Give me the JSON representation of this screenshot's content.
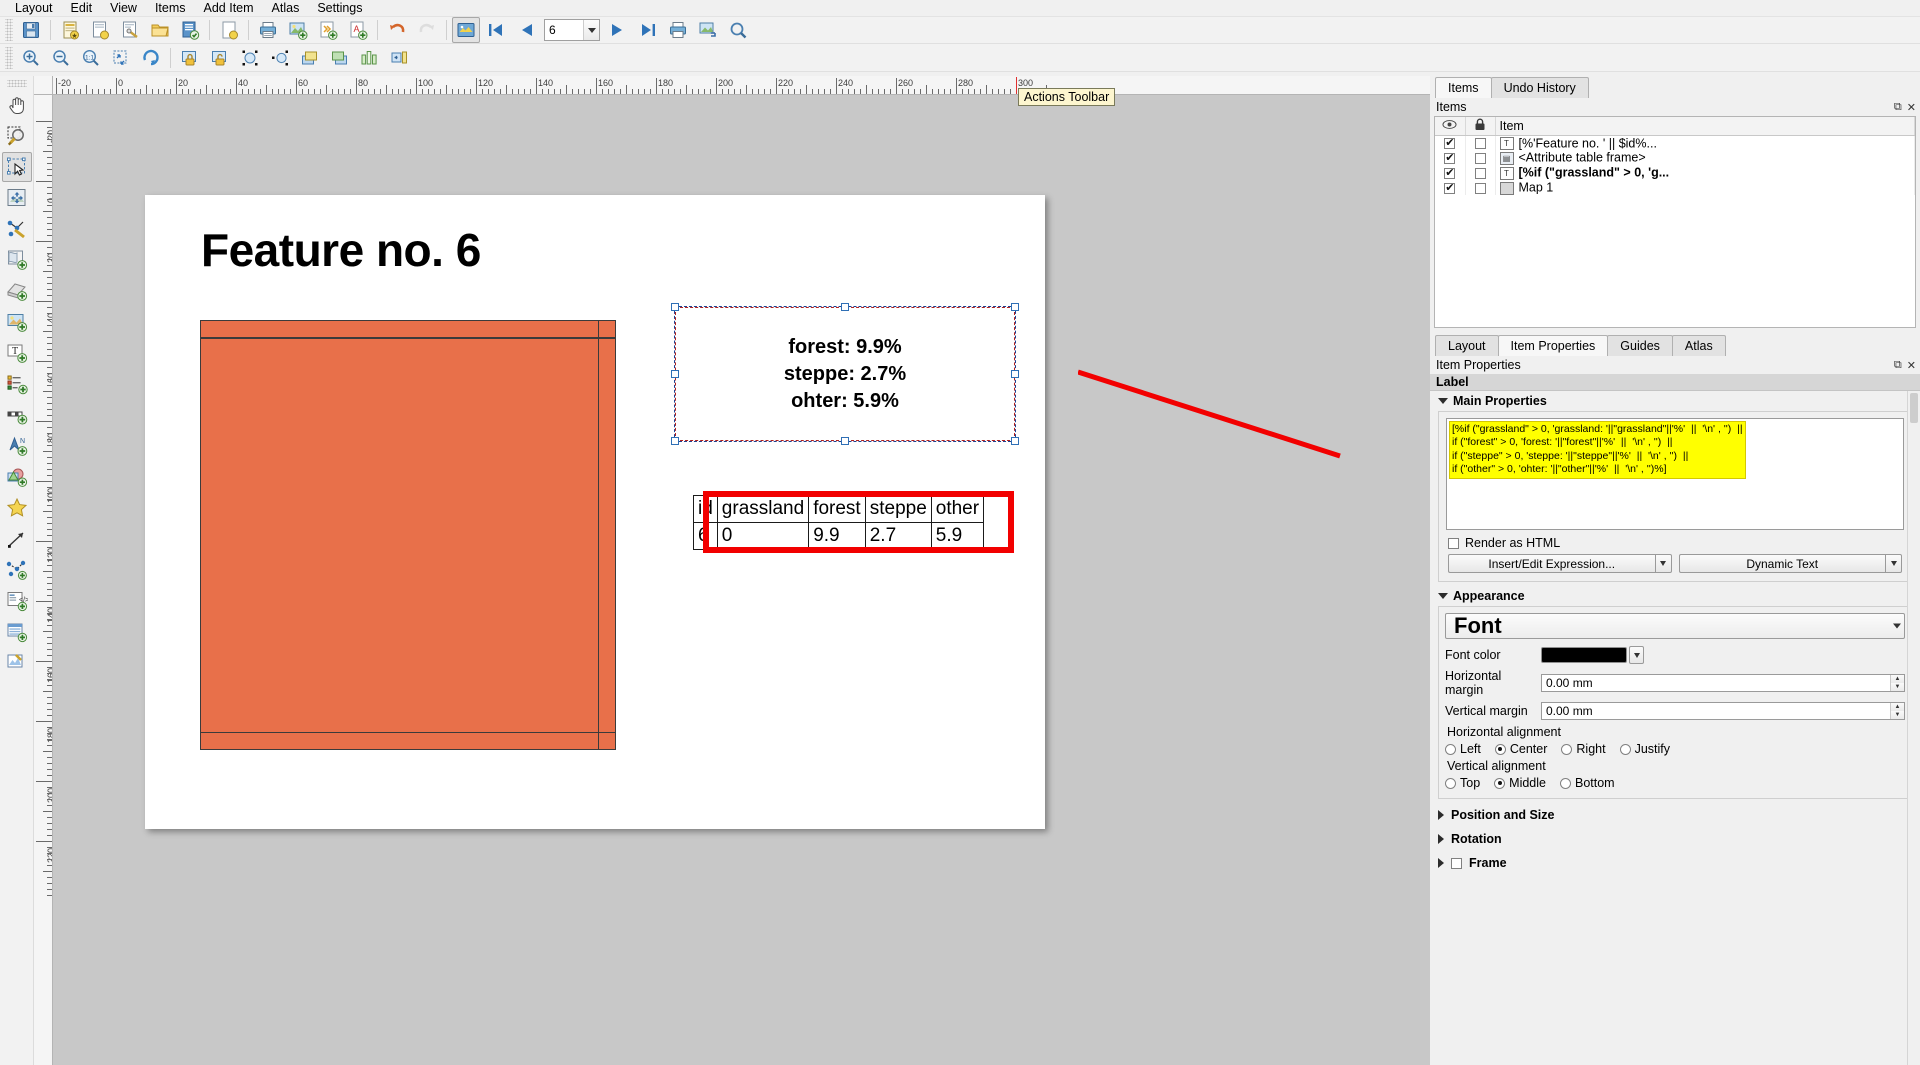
{
  "menubar": {
    "items": [
      {
        "label": "Layout"
      },
      {
        "label": "Edit"
      },
      {
        "label": "View"
      },
      {
        "label": "Items"
      },
      {
        "label": "Add Item"
      },
      {
        "label": "Atlas"
      },
      {
        "label": "Settings"
      }
    ]
  },
  "toolbar_main": {
    "buttons": [
      {
        "name": "save-project",
        "icon": "save-icon",
        "title": "Save Project"
      },
      {
        "name": "new-layout",
        "icon": "new-layout-icon",
        "title": "New Layout"
      },
      {
        "name": "duplicate-layout",
        "icon": "duplicate-layout-icon",
        "title": "Duplicate Layout"
      },
      {
        "name": "layout-manager",
        "icon": "layout-manager-icon",
        "title": "Layout Manager"
      },
      {
        "name": "open-template",
        "icon": "folder-icon",
        "title": "Add Items from Template"
      },
      {
        "name": "save-template",
        "icon": "save-template-icon",
        "title": "Save as Template"
      },
      {
        "name": "new-page",
        "icon": "page-icon",
        "title": "Add Pages"
      },
      {
        "name": "print-layout",
        "icon": "printer-icon",
        "title": "Print Layout"
      },
      {
        "name": "export-image",
        "icon": "export-image-icon",
        "title": "Export as Image"
      },
      {
        "name": "export-svg",
        "icon": "export-svg-icon",
        "title": "Export as SVG"
      },
      {
        "name": "export-pdf",
        "icon": "export-pdf-icon",
        "title": "Export as PDF"
      },
      {
        "name": "undo",
        "icon": "undo-arrow-icon",
        "title": "Undo"
      },
      {
        "name": "redo",
        "icon": "redo-arrow-icon",
        "title": "Redo",
        "disabled": true
      }
    ]
  },
  "toolbar_atlas": {
    "preview_atlas_title": "Preview Atlas",
    "first_feature_title": "First Feature",
    "previous_feature_title": "Previous Feature",
    "next_feature_title": "Next Feature",
    "last_feature_title": "Last Feature",
    "print_atlas_title": "Print Atlas",
    "export_atlas_title": "Export Atlas",
    "atlas_settings_title": "Atlas Settings",
    "feature_number": "6"
  },
  "toolbar_nav": {
    "buttons": [
      {
        "name": "zoom-in",
        "icon": "zoom-in-icon"
      },
      {
        "name": "zoom-out",
        "icon": "zoom-out-icon"
      },
      {
        "name": "zoom-full",
        "icon": "zoom-1to1-icon"
      },
      {
        "name": "zoom-to-width",
        "icon": "zoom-width-icon"
      },
      {
        "name": "refresh-view",
        "icon": "refresh-icon"
      },
      {
        "name": "lock-selected-items",
        "icon": "lock-icon"
      },
      {
        "name": "unlock-all-items",
        "icon": "unlock-icon"
      },
      {
        "name": "group-items",
        "icon": "group-icon"
      },
      {
        "name": "ungroup-items",
        "icon": "ungroup-icon"
      },
      {
        "name": "raise-items",
        "icon": "raise-icon"
      },
      {
        "name": "lower-items",
        "icon": "lower-icon"
      },
      {
        "name": "bring-to-front",
        "icon": "front-icon"
      },
      {
        "name": "send-to-back",
        "icon": "back-icon"
      },
      {
        "name": "align-left",
        "icon": "align-left-icon"
      },
      {
        "name": "align-center",
        "icon": "align-center-icon"
      },
      {
        "name": "distribute",
        "icon": "distribute-icon"
      }
    ]
  },
  "left_toolbar": {
    "buttons": [
      {
        "name": "pan-layout-tool",
        "icon": "hand-icon",
        "checked": false
      },
      {
        "name": "zoom-tool",
        "icon": "magnifier-icon",
        "checked": false
      },
      {
        "name": "select-move-item-tool",
        "icon": "select-arrow-icon",
        "checked": true
      },
      {
        "name": "move-item-content-tool",
        "icon": "move-content-icon",
        "checked": false
      },
      {
        "name": "edit-nodes-tool",
        "icon": "edit-nodes-icon",
        "checked": false
      },
      {
        "name": "add-map",
        "icon": "add-map-icon",
        "checked": false
      },
      {
        "name": "add-3d-map",
        "icon": "add-3d-map-icon",
        "checked": false
      },
      {
        "name": "add-picture",
        "icon": "add-picture-icon",
        "checked": false
      },
      {
        "name": "add-label",
        "icon": "add-label-icon",
        "checked": false
      },
      {
        "name": "add-legend",
        "icon": "add-legend-icon",
        "checked": false
      },
      {
        "name": "add-scalebar",
        "icon": "add-scalebar-icon",
        "checked": false
      },
      {
        "name": "add-north-arrow",
        "icon": "add-north-arrow-icon",
        "checked": false
      },
      {
        "name": "add-shape",
        "icon": "add-shape-icon",
        "checked": false
      },
      {
        "name": "add-marker",
        "icon": "add-marker-icon",
        "checked": false
      },
      {
        "name": "add-arrow",
        "icon": "add-arrow-icon",
        "checked": false
      },
      {
        "name": "add-node-item",
        "icon": "add-node-item-icon",
        "checked": false
      },
      {
        "name": "add-html",
        "icon": "add-html-icon",
        "checked": false
      },
      {
        "name": "add-attribute-table",
        "icon": "add-attribute-table-icon",
        "checked": false
      },
      {
        "name": "add-elevation-profile",
        "icon": "add-elevation-profile-icon",
        "checked": false
      }
    ]
  },
  "tooltip": {
    "text": "Actions Toolbar"
  },
  "rulers": {
    "horizontal_labels": [
      "-20",
      "0",
      "20",
      "40",
      "60",
      "80",
      "100",
      "120",
      "140",
      "160",
      "180",
      "200",
      "220",
      "240",
      "260",
      "280",
      "300"
    ],
    "vertical_labels": [
      "-20",
      "0",
      "20",
      "40",
      "60",
      "80",
      "100",
      "120",
      "140",
      "160",
      "180",
      "200",
      "220"
    ],
    "unit": "mm"
  },
  "canvas": {
    "page_title": "Feature no. 6",
    "label_lines": [
      "forest: 9.9%",
      "steppe: 2.7%",
      "ohter: 5.9%"
    ],
    "map_item_name": "Map 1",
    "map_fill_color": "#e8704a",
    "attribute_table": {
      "headers": [
        "id",
        "grassland",
        "forest",
        "steppe",
        "other"
      ],
      "rows": [
        [
          "6",
          "0",
          "9.9",
          "2.7",
          "5.9"
        ]
      ]
    },
    "highlight_color": "#f20000"
  },
  "items_dock": {
    "tabs": [
      {
        "label": "Items",
        "active": true
      },
      {
        "label": "Undo History",
        "active": false
      }
    ],
    "panel_title": "Items",
    "columns": [
      "",
      "",
      "Item"
    ],
    "rows": [
      {
        "visible": true,
        "locked": false,
        "icon": "text-label-icon",
        "label": "[%'Feature no. ' || $id%...",
        "bold": false
      },
      {
        "visible": true,
        "locked": false,
        "icon": "attribute-table-icon",
        "label": "<Attribute table frame>",
        "bold": false
      },
      {
        "visible": true,
        "locked": false,
        "icon": "text-label-icon",
        "label": "[%if (\"grassland\" > 0, 'g...",
        "bold": true
      },
      {
        "visible": true,
        "locked": false,
        "icon": "map-icon",
        "label": "Map 1",
        "bold": false
      }
    ]
  },
  "properties_dock": {
    "tabs": [
      {
        "label": "Layout",
        "active": false
      },
      {
        "label": "Item Properties",
        "active": true
      },
      {
        "label": "Guides",
        "active": false
      },
      {
        "label": "Atlas",
        "active": false
      }
    ],
    "panel_title": "Item Properties",
    "section_title": "Label",
    "main_properties": {
      "group_label": "Main Properties",
      "expression_lines": [
        "[%if (\"grassland\" > 0, 'grassland: '||\"grassland\"||'%'  ||  '\\n' , '')  ||",
        "if (\"forest\" > 0, 'forest: '||\"forest\"||'%'  ||  '\\n' , '')  ||",
        "if (\"steppe\" > 0, 'steppe: '||\"steppe\"||'%'  ||  '\\n' , '')  ||",
        "if (\"other\" > 0, 'ohter: '||\"other\"||'%'  ||  '\\n' , '')%]"
      ],
      "render_as_html_label": "Render as HTML",
      "render_as_html_checked": false,
      "insert_expression_button": "Insert/Edit Expression...",
      "dynamic_text_button": "Dynamic Text"
    },
    "appearance": {
      "group_label": "Appearance",
      "font_button_label": "Font",
      "font_color_label": "Font color",
      "font_color_value": "#000000",
      "horizontal_margin_label": "Horizontal margin",
      "horizontal_margin_value": "0.00 mm",
      "vertical_margin_label": "Vertical margin",
      "vertical_margin_value": "0.00 mm",
      "horizontal_alignment_label": "Horizontal alignment",
      "horizontal_alignment_options": [
        "Left",
        "Center",
        "Right",
        "Justify"
      ],
      "horizontal_alignment_selected": "Center",
      "vertical_alignment_label": "Vertical alignment",
      "vertical_alignment_options": [
        "Top",
        "Middle",
        "Bottom"
      ],
      "vertical_alignment_selected": "Middle"
    },
    "collapsed_sections": [
      {
        "label": "Position and Size",
        "has_checkbox": false
      },
      {
        "label": "Rotation",
        "has_checkbox": false
      },
      {
        "label": "Frame",
        "has_checkbox": true,
        "checked": false
      }
    ]
  }
}
